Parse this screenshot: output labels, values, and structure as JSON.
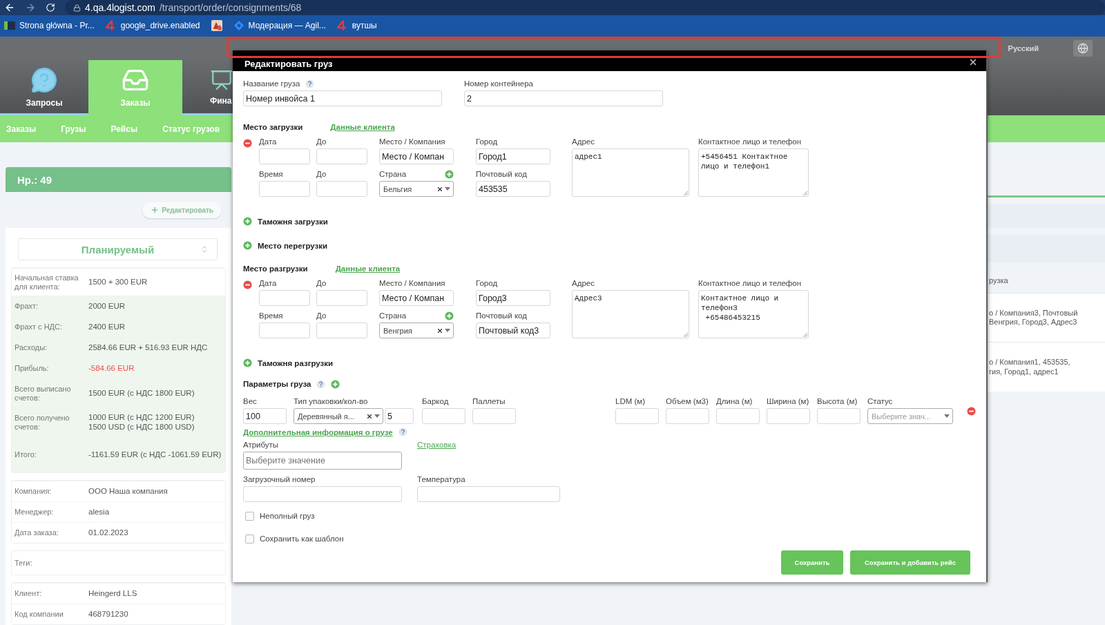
{
  "browser": {
    "url_host": "4.qa.4logist.com",
    "url_path": "/transport/order/consignments/68",
    "bookmarks": [
      {
        "kind": "page",
        "label": "Strona główna - Pr..."
      },
      {
        "kind": "four",
        "label": "google_drive.enabled"
      },
      {
        "kind": "app"
      },
      {
        "kind": "diamond",
        "label": "Модерация — Agil..."
      },
      {
        "kind": "four",
        "label": "вутшы"
      }
    ]
  },
  "header": {
    "language": "Русский"
  },
  "nav_tiles": [
    {
      "label": "Запросы",
      "selected": false
    },
    {
      "label": "Заказы",
      "selected": true
    },
    {
      "label": "Фина",
      "selected": false
    }
  ],
  "subnav": [
    "Заказы",
    "Грузы",
    "Рейсы",
    "Статус грузов"
  ],
  "order": {
    "title": "Нр.: 49",
    "edit_button": "Редактировать",
    "status": "Планируемый",
    "finance_rows": [
      {
        "label": "Начальная ставка для клиента:",
        "value": "1500 + 300 EUR",
        "tinted": false,
        "negative": false
      },
      {
        "label": "Фрахт:",
        "value": "2000 EUR",
        "tinted": true,
        "negative": false
      },
      {
        "label": "Фрахт с НДС:",
        "value": "2400 EUR",
        "tinted": true,
        "negative": false
      },
      {
        "label": "Расходы:",
        "value": "2584.66 EUR + 516.93 EUR НДС",
        "tinted": true,
        "negative": false
      },
      {
        "label": "Прибыль:",
        "value": "-584.66 EUR",
        "tinted": true,
        "negative": true
      },
      {
        "label": "Всего выписано счетов:",
        "value": "1500 EUR (с НДС 1800 EUR)",
        "tinted": true,
        "negative": false
      },
      {
        "label": "Всего получено счетов:",
        "value": "1000 EUR (с НДС 1200 EUR)\n1500 USD (с НДС 1800 USD)",
        "tinted": true,
        "negative": false
      },
      {
        "label": "Итого:",
        "value": "-1161.59 EUR (с НДС -1061.59 EUR)",
        "tinted": true,
        "negative": false
      }
    ],
    "info_rows": [
      {
        "label": "Компания:",
        "value": "ООО Наша компания"
      },
      {
        "label": "Менеджер:",
        "value": "alesia"
      },
      {
        "label": "Дата заказа:",
        "value": "01.02.2023"
      }
    ],
    "tags_label": "Теги:",
    "client_rows": [
      {
        "label": "Клиент:",
        "value": "Heingerd LLS"
      },
      {
        "label": "Код компании",
        "value": "468791230"
      }
    ]
  },
  "background_panel": {
    "heading": "рузка",
    "entries": [
      [
        "о / Компания3, Почтовый",
        "Венгрия, Город3, Адрес3"
      ],
      [
        "о / Компания1, 453535,",
        "гия, Город1, адрес1"
      ]
    ]
  },
  "modal": {
    "title": "Редактировать груз",
    "name_label": "Название груза",
    "name_value": "Номер инвойса 1",
    "container_label": "Номер контейнера",
    "container_value": "2",
    "stops": [
      {
        "heading": "Место загрузки",
        "client_link": "Данные клиента",
        "date_label": "Дата",
        "to_label": "До",
        "time_label": "Время",
        "to2_label": "До",
        "place_label": "Место / Компания",
        "place_value": "Место / Компан",
        "country_label": "Страна",
        "country_value": "Бельгия",
        "city_label": "Город",
        "city_value": "Город1",
        "postcode_label": "Почтовый код",
        "postcode_value": "453535",
        "address_label": "Адрес",
        "address_value": "адрес1",
        "contact_label": "Контактное лицо и телефон",
        "contact_value": "+5456451 Контактное лицо и телефон1",
        "after": [
          "Таможня загрузки",
          "Место перегрузки"
        ]
      },
      {
        "heading": "Место разгрузки",
        "client_link": "Данные клиента",
        "date_label": "Дата",
        "to_label": "До",
        "time_label": "Время",
        "to2_label": "До",
        "place_label": "Место / Компания",
        "place_value": "Место / Компан",
        "country_label": "Страна",
        "country_value": "Венгрия",
        "city_label": "Город",
        "city_value": "Город3",
        "postcode_label": "Почтовый код",
        "postcode_value": "Почтовый код3",
        "address_label": "Адрес",
        "address_value": "Адрес3",
        "contact_label": "Контактное лицо и телефон",
        "contact_value": "Контактное лицо и телефон3\n +65486453215",
        "after": [
          "Таможня разгрузки"
        ]
      }
    ],
    "params_heading": "Параметры груза",
    "params": [
      {
        "kind": "input",
        "label": "Вес",
        "value": "100"
      },
      {
        "kind": "package",
        "label": "Тип упаковки/кол-во",
        "value": "Деревянный я...",
        "qty": "5"
      },
      {
        "kind": "input",
        "label": "Баркод"
      },
      {
        "kind": "input",
        "label": "Паллеты"
      },
      {
        "kind": "input",
        "label": "LDM (м)"
      },
      {
        "kind": "input",
        "label": "Объем (м3)"
      },
      {
        "kind": "input",
        "label": "Длина (м)"
      },
      {
        "kind": "input",
        "label": "Ширина (м)"
      },
      {
        "kind": "input",
        "label": "Высота (м)"
      },
      {
        "kind": "select",
        "label": "Статус",
        "placeholder": "Выберите знач..."
      }
    ],
    "extra_link": "Дополнительная информация о грузе",
    "attributes_label": "Атрибуты",
    "attributes_placeholder": "Выберите значение",
    "insurance_link": "Страховка",
    "loading_number_label": "Загрузочный номер",
    "temperature_label": "Температура",
    "checkboxes": [
      {
        "label": "Неполный груз",
        "checked": false
      },
      {
        "label": "Сохранить как шаблон",
        "checked": false
      }
    ],
    "buttons": [
      {
        "label": "Сохранить",
        "wide": false
      },
      {
        "label": "Сохранить и добавить рейс",
        "wide": true
      }
    ]
  }
}
